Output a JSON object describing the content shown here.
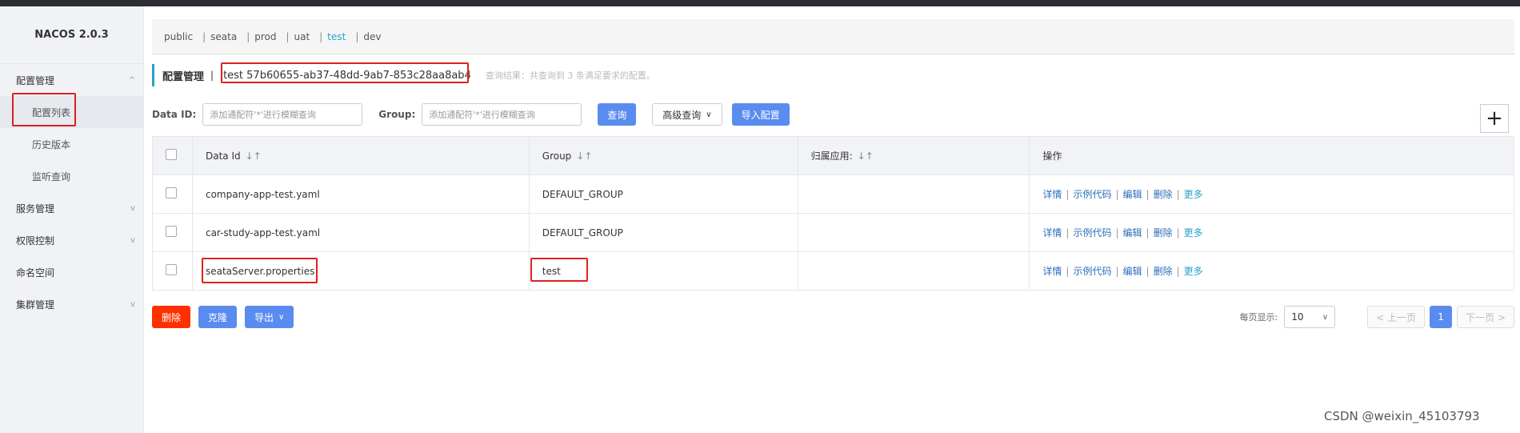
{
  "brand": "NACOS 2.0.3",
  "sidebar": {
    "groups": [
      {
        "label": "配置管理",
        "chevron": "^"
      },
      {
        "label": "服务管理",
        "chevron": "v"
      },
      {
        "label": "权限控制",
        "chevron": "v"
      },
      {
        "label": "命名空间",
        "chevron": ""
      },
      {
        "label": "集群管理",
        "chevron": "v"
      }
    ],
    "subs": [
      "配置列表",
      "历史版本",
      "监听查询"
    ]
  },
  "namespaces": [
    {
      "label": "public"
    },
    {
      "label": "seata"
    },
    {
      "label": "prod"
    },
    {
      "label": "uat"
    },
    {
      "label": "test"
    },
    {
      "label": "dev"
    }
  ],
  "ns_sep": "|",
  "title": "配置管理",
  "title_sep": "|",
  "namespace_id": "test  57b60655-ab37-48dd-9ab7-853c28aa8ab4",
  "query_result": "查询结果：共查询到 3 条满足要求的配置。",
  "filters": {
    "dataid_label": "Data ID:",
    "dataid_placeholder": "添加通配符'*'进行模糊查询",
    "group_label": "Group:",
    "group_placeholder": "添加通配符'*'进行模糊查询",
    "query_btn": "查询",
    "advanced_btn": "高级查询",
    "import_btn": "导入配置",
    "plus": "+"
  },
  "table": {
    "headers": [
      "Data Id",
      "Group",
      "归属应用:",
      "操作"
    ],
    "sort_icon": "↓↑",
    "rows": [
      {
        "dataid": "company-app-test.yaml",
        "group": "DEFAULT_GROUP",
        "app": ""
      },
      {
        "dataid": "car-study-app-test.yaml",
        "group": "DEFAULT_GROUP",
        "app": ""
      },
      {
        "dataid": "seataServer.properties",
        "group": "test",
        "app": ""
      }
    ],
    "ops": [
      "详情",
      "示例代码",
      "编辑",
      "删除",
      "更多"
    ],
    "op_sep": "|"
  },
  "bottom": {
    "delete_btn": "删除",
    "clone_btn": "克隆",
    "export_btn": "导出",
    "page_size_label": "每页显示:",
    "page_size": "10",
    "prev": "< 上一页",
    "current_page": "1",
    "next": "下一页 >"
  },
  "watermark": "CSDN @weixin_45103793",
  "colors": {
    "accent": "#5a8cf0",
    "danger": "#ff3000",
    "highlight_box": "#e02020",
    "active_ns": "#2aa1cc"
  }
}
